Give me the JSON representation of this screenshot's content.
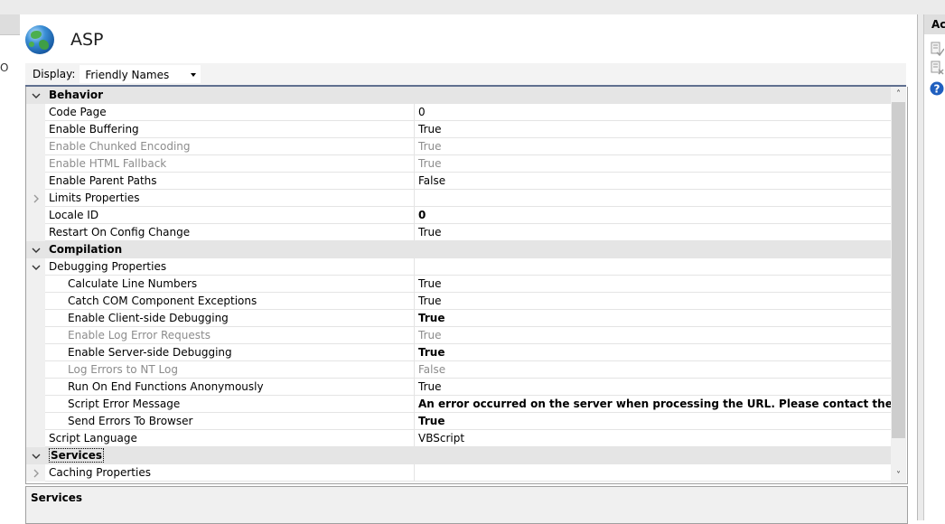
{
  "window": {
    "left_fragment": "O"
  },
  "feature": {
    "title": "ASP",
    "icon": "globe-icon"
  },
  "toolbar": {
    "display_label": "Display:",
    "display_value": "Friendly Names"
  },
  "actions": {
    "header": "Ac"
  },
  "grid": {
    "rows": [
      {
        "kind": "cat",
        "label": "Behavior",
        "expanded": true
      },
      {
        "kind": "prop",
        "name": "Code Page",
        "value": "0"
      },
      {
        "kind": "prop",
        "name": "Enable Buffering",
        "value": "True"
      },
      {
        "kind": "prop",
        "name": "Enable Chunked Encoding",
        "value": "True",
        "disabled": true
      },
      {
        "kind": "prop",
        "name": "Enable HTML Fallback",
        "value": "True",
        "disabled": true
      },
      {
        "kind": "prop",
        "name": "Enable Parent Paths",
        "value": "False"
      },
      {
        "kind": "prop",
        "name": "Limits Properties",
        "value": "",
        "collapsed": true
      },
      {
        "kind": "prop",
        "name": "Locale ID",
        "value": "0",
        "bold": true
      },
      {
        "kind": "prop",
        "name": "Restart On Config Change",
        "value": "True"
      },
      {
        "kind": "cat",
        "label": "Compilation",
        "expanded": true
      },
      {
        "kind": "prop",
        "name": "Debugging Properties",
        "value": "",
        "expanded": true
      },
      {
        "kind": "prop",
        "name": "Calculate Line Numbers",
        "value": "True",
        "sub": true
      },
      {
        "kind": "prop",
        "name": "Catch COM Component Exceptions",
        "value": "True",
        "sub": true
      },
      {
        "kind": "prop",
        "name": "Enable Client-side Debugging",
        "value": "True",
        "sub": true,
        "bold": true
      },
      {
        "kind": "prop",
        "name": "Enable Log Error Requests",
        "value": "True",
        "sub": true,
        "disabled": true
      },
      {
        "kind": "prop",
        "name": "Enable Server-side Debugging",
        "value": "True",
        "sub": true,
        "bold": true
      },
      {
        "kind": "prop",
        "name": "Log Errors to NT Log",
        "value": "False",
        "sub": true,
        "disabled": true
      },
      {
        "kind": "prop",
        "name": "Run On End Functions Anonymously",
        "value": "True",
        "sub": true
      },
      {
        "kind": "prop",
        "name": "Script Error Message",
        "value": "An error occurred on the server when processing the URL. Please contact the system administrator.",
        "sub": true,
        "bold": true
      },
      {
        "kind": "prop",
        "name": "Send Errors To Browser",
        "value": "True",
        "sub": true,
        "bold": true
      },
      {
        "kind": "prop",
        "name": "Script Language",
        "value": "VBScript"
      },
      {
        "kind": "cat",
        "label": "Services",
        "expanded": true,
        "selected": true
      },
      {
        "kind": "prop",
        "name": "Caching Properties",
        "value": "",
        "collapsed": true
      }
    ]
  },
  "description": {
    "title": "Services"
  },
  "colors": {
    "header_underline": "#5f6f8f",
    "disabled_text": "#8c8c8c",
    "category_bg": "#e5e5e5"
  }
}
